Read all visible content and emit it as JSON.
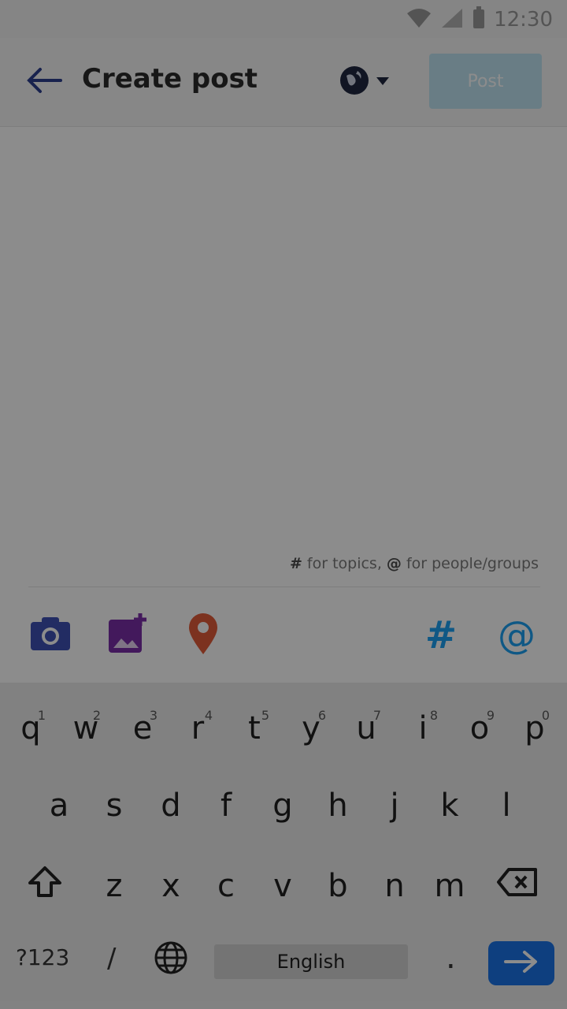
{
  "status": {
    "time": "12:30"
  },
  "appbar": {
    "title": "Create post",
    "post_label": "Post"
  },
  "editor": {
    "hint_hash": "#",
    "hint_topics": " for topics, ",
    "hint_at": "@",
    "hint_people": " for people/groups"
  },
  "toolbar": {
    "hash": "#",
    "at": "@",
    "colors": {
      "camera": "#3f51b5",
      "image": "#7b2ea8",
      "location": "#e25b3a",
      "accent": "#1da1f2"
    }
  },
  "keyboard": {
    "row1": [
      {
        "k": "q",
        "n": "1"
      },
      {
        "k": "w",
        "n": "2"
      },
      {
        "k": "e",
        "n": "3"
      },
      {
        "k": "r",
        "n": "4"
      },
      {
        "k": "t",
        "n": "5"
      },
      {
        "k": "y",
        "n": "6"
      },
      {
        "k": "u",
        "n": "7"
      },
      {
        "k": "i",
        "n": "8"
      },
      {
        "k": "o",
        "n": "9"
      },
      {
        "k": "p",
        "n": "0"
      }
    ],
    "row2": [
      "a",
      "s",
      "d",
      "f",
      "g",
      "h",
      "j",
      "k",
      "l"
    ],
    "row3": [
      "z",
      "x",
      "c",
      "v",
      "b",
      "n",
      "m"
    ],
    "nums": "?123",
    "slash": "/",
    "space": "English",
    "dot": "."
  }
}
